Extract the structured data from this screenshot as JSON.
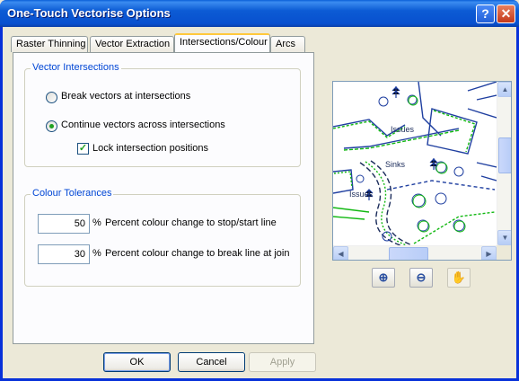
{
  "window": {
    "title": "One-Touch Vectorise Options",
    "help_glyph": "?",
    "close_glyph": "✕"
  },
  "tabs": [
    {
      "label": "Raster Thinning"
    },
    {
      "label": "Vector Extraction"
    },
    {
      "label": "Intersections/Colour",
      "active": true
    },
    {
      "label": "Arcs"
    }
  ],
  "vector_intersections": {
    "title": "Vector Intersections",
    "break_label": "Break vectors at intersections",
    "break_selected": false,
    "continue_label": "Continue vectors across intersections",
    "continue_selected": true,
    "lock_label": "Lock intersection positions",
    "lock_checked": true,
    "check_glyph": "✓"
  },
  "colour_tolerances": {
    "title": "Colour Tolerances",
    "stop_value": "50",
    "stop_unit": "%",
    "stop_label": "Percent colour change to stop/start line",
    "break_value": "30",
    "break_unit": "%",
    "break_label": "Percent colour change to break line at join"
  },
  "preview": {
    "labels": [
      "Issues",
      "Sinks",
      "Issues"
    ],
    "colors": {
      "vector": "#11b811",
      "raster": "#1f3fa0",
      "road": "#1a2b5a"
    }
  },
  "zoom": {
    "zoom_in_glyph": "⊕",
    "zoom_out_glyph": "⊖",
    "pan_glyph": "✋"
  },
  "buttons": {
    "ok": "OK",
    "cancel": "Cancel",
    "apply": "Apply"
  },
  "scroll_glyphs": {
    "up": "▲",
    "down": "▼",
    "left": "◀",
    "right": "▶"
  }
}
